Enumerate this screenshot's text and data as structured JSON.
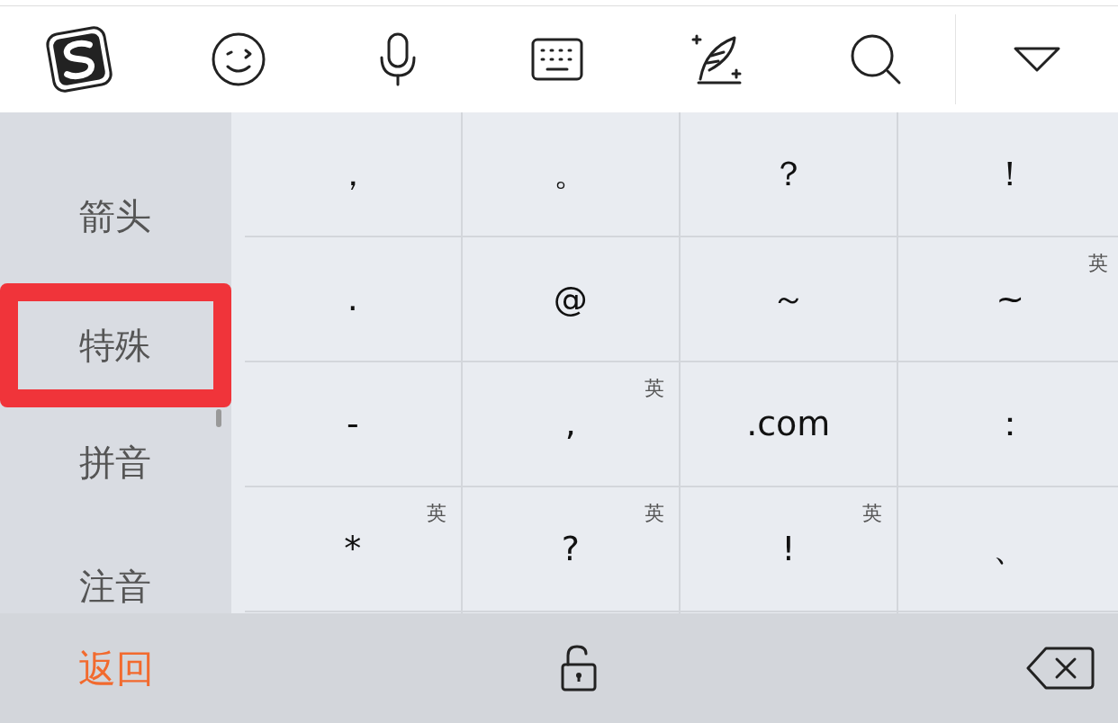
{
  "categories": [
    {
      "label": "箭头",
      "highlighted": false
    },
    {
      "label": "特殊",
      "highlighted": true
    },
    {
      "label": "拼音",
      "highlighted": false
    },
    {
      "label": "注音",
      "highlighted": false
    }
  ],
  "symbols": [
    {
      "symbol": "，"
    },
    {
      "symbol": "。"
    },
    {
      "symbol": "？"
    },
    {
      "symbol": "！"
    },
    {
      "symbol": "."
    },
    {
      "symbol": "@"
    },
    {
      "symbol": "～"
    },
    {
      "symbol": "~",
      "tag": "英"
    },
    {
      "symbol": "-"
    },
    {
      "symbol": ",",
      "tag": "英"
    },
    {
      "symbol": ".com"
    },
    {
      "symbol": "："
    },
    {
      "symbol": "*",
      "tag": "英"
    },
    {
      "symbol": "?",
      "tag": "英"
    },
    {
      "symbol": "!",
      "tag": "英"
    },
    {
      "symbol": "、"
    }
  ],
  "bottom_bar": {
    "back": "返回"
  }
}
